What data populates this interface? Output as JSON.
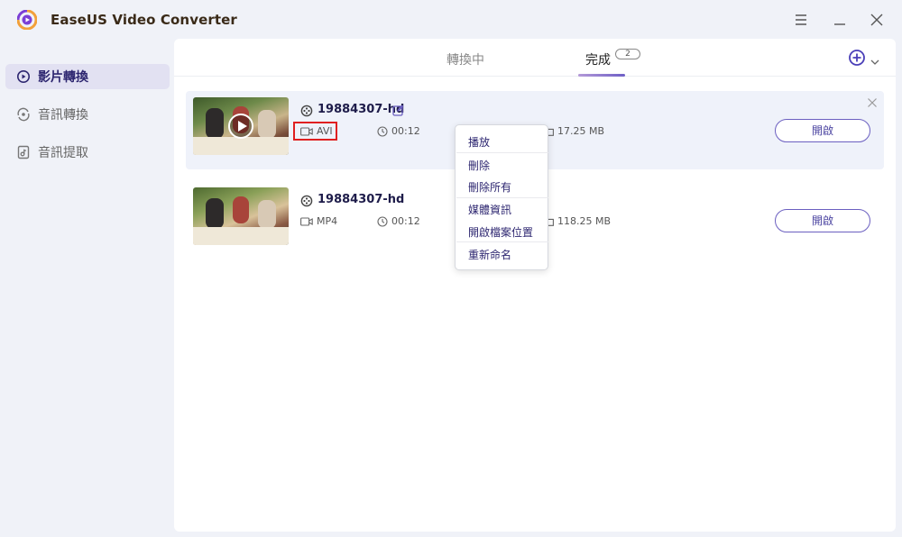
{
  "app": {
    "title": "EaseUS Video Converter",
    "accent": "#5a4fc0",
    "highlight": "#e02020"
  },
  "sidebar": {
    "items": [
      {
        "label": "影片轉換",
        "icon": "video-convert-icon",
        "active": true
      },
      {
        "label": "音訊轉換",
        "icon": "audio-convert-icon",
        "active": false
      },
      {
        "label": "音訊提取",
        "icon": "audio-extract-icon",
        "active": false
      }
    ]
  },
  "tabs": [
    {
      "label": "轉換中",
      "active": false
    },
    {
      "label": "完成",
      "active": true,
      "badge": "2"
    }
  ],
  "files": [
    {
      "name": "19884307-hd",
      "format": "AVI",
      "duration": "00:12",
      "size": "17.25 MB",
      "open_label": "開啟"
    },
    {
      "name": "19884307-hd",
      "format": "MP4",
      "duration": "00:12",
      "size": "118.25 MB",
      "open_label": "開啟"
    }
  ],
  "context_menu": {
    "items": [
      "播放",
      "刪除",
      "刪除所有",
      "媒體資訊",
      "開啟檔案位置",
      "重新命名"
    ]
  }
}
